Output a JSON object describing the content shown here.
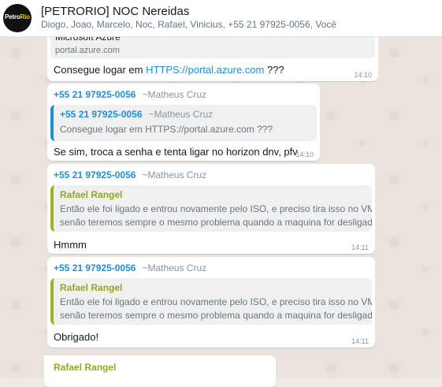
{
  "header": {
    "title": "[PETRORIO] NOC Nereidas",
    "participants": "Diogo, Joao, Marcelo, Noc, Rafael, Vinicius, +55 21 97925-0056, Você",
    "avatar_logo_main": "Petro",
    "avatar_logo_accent": "Rio"
  },
  "messages": [
    {
      "link_preview_title": "Microsoft Azure",
      "link_preview_domain": "portal.azure.com",
      "text_before": "Consegue logar em ",
      "link": "HTTPS://portal.azure.com",
      "text_after": " ???",
      "time": "14:10"
    },
    {
      "sender_phone": "+55 21 97925-0056",
      "sender_alias": "~Matheus Cruz",
      "quote_phone": "+55 21 97925-0056",
      "quote_alias": "~Matheus Cruz",
      "quote_text": "Consegue logar em HTTPS://portal.azure.com ???",
      "text": "Se sim, troca a senha e tenta ligar no horizon dnv, pfv",
      "time": "14:10"
    },
    {
      "sender_phone": "+55 21 97925-0056",
      "sender_alias": "~Matheus Cruz",
      "quote_name": "Rafael Rangel",
      "quote_line1": "Então ele foi ligado e entrou novamente pelo ISO, e preciso tira isso no VM,",
      "quote_line2": "senão teremos sempre o mesmo problema quando a maquina for desligada",
      "text": "Hmmm",
      "time": "14:11"
    },
    {
      "sender_phone": "+55 21 97925-0056",
      "sender_alias": "~Matheus Cruz",
      "quote_name": "Rafael Rangel",
      "quote_line1": "Então ele foi ligado e entrou novamente pelo ISO, e preciso tira isso no VM,",
      "quote_line2": "senão teremos sempre o mesmo problema quando a maquina for desligada",
      "text": "Obrigado!",
      "time": "14:11"
    },
    {
      "sender_name": "Rafael Rangel"
    }
  ],
  "colors": {
    "link": "#1f8fd6",
    "quote_green": "#93a81f",
    "time": "#8696a0"
  }
}
